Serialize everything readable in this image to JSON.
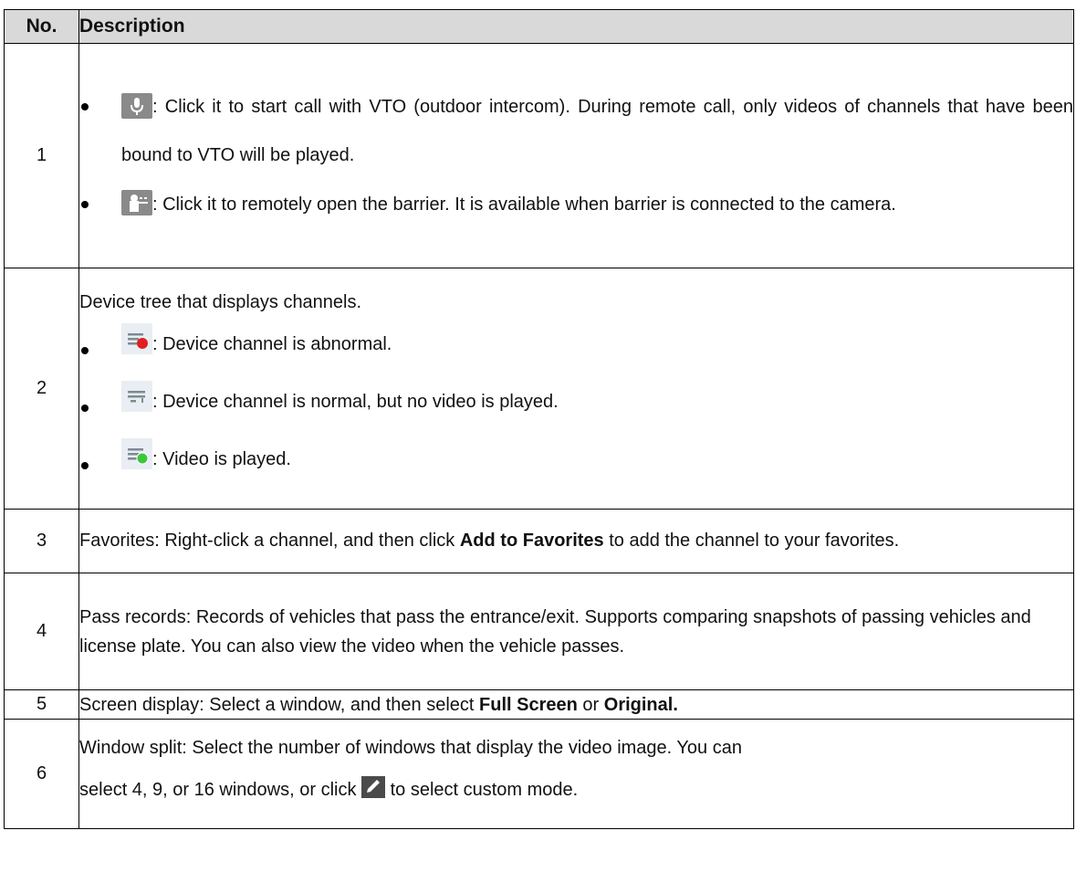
{
  "table": {
    "header": {
      "no": "No.",
      "description": "Description"
    },
    "rows": [
      {
        "no": "1",
        "bullets": [
          {
            "icon": "microphone-icon",
            "text": ": Click it to start call with VTO (outdoor intercom). During remote call, only videos of channels that have been bound to VTO will be played."
          },
          {
            "icon": "barrier-open-icon",
            "text": ": Click it to remotely open the barrier. It is available when barrier is connected to the camera."
          }
        ]
      },
      {
        "no": "2",
        "intro": "Device tree that displays channels.",
        "bullets": [
          {
            "icon": "channel-abnormal-icon",
            "text": ": Device channel is abnormal."
          },
          {
            "icon": "channel-normal-icon",
            "text": ": Device channel is normal, but no video is played."
          },
          {
            "icon": "channel-playing-icon",
            "text": ": Video is played."
          }
        ]
      },
      {
        "no": "3",
        "pre": "Favorites: Right-click a channel, and then click ",
        "bold": "Add to Favorites",
        "post": " to add the channel to your favorites."
      },
      {
        "no": "4",
        "text": "Pass records: Records of vehicles that pass the entrance/exit. Supports comparing snapshots of passing vehicles and license plate. You can also view the video when the vehicle passes."
      },
      {
        "no": "5",
        "pre": "Screen display: Select a window, and then select ",
        "bold1": "Full Screen",
        "mid": " or ",
        "bold2": "Original."
      },
      {
        "no": "6",
        "line1": "Window split: Select the number of windows that display the video image. You can",
        "line2_pre": "select 4, 9, or 16 windows, or click ",
        "line2_icon": "edit-icon",
        "line2_post": " to select custom mode."
      }
    ]
  },
  "colors": {
    "header_bg": "#d9d9d9",
    "icon_gray": "#8a8a8a",
    "icon_red": "#e02020",
    "icon_green": "#3cc63c"
  }
}
